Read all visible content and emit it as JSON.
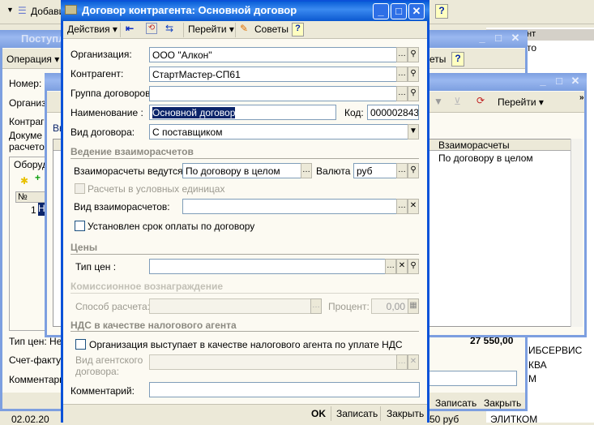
{
  "app": {
    "toolbar_add": "Добави",
    "help": "?"
  },
  "bg_list": {
    "header": "нт",
    "rows": [
      "то",
      "ИБСЕРВИС",
      "КВА",
      "М",
      "ЭЛИТКОМ"
    ],
    "bottom_row": {
      "date": "02.02.20",
      "sum": "50 руб"
    }
  },
  "doc_window": {
    "title": "Поступл",
    "operation": "Операция",
    "tips_fragment": "еты",
    "number_label": "Номер:",
    "org_label": "Организ",
    "counterparty_label": "Контраг",
    "doc_label": "Докуме",
    "settlements_label": "расчето",
    "group_tab": "Оборуд",
    "col_num": "№",
    "row_num": "1",
    "row_h": "Н",
    "price_type": "Тип цен: Не",
    "total": "27 550,00",
    "invoice": "Счет-фактур",
    "comment": "Комментари",
    "save": "Записать",
    "close": "Закрыть"
  },
  "journal_window": {
    "title": "Де",
    "goto": "Перейти",
    "link": "Вв",
    "col": "Взаиморасчеты",
    "row": "По договору в целом"
  },
  "dialog": {
    "title": "Договор контрагента: Основной договор",
    "toolbar": {
      "actions": "Действия",
      "goto": "Перейти",
      "tips": "Советы",
      "help": "?"
    },
    "organization": {
      "label": "Организация:",
      "value": "ООО \"Алкон\""
    },
    "counterparty": {
      "label": "Контрагент:",
      "value": "СтартМастер-СП61"
    },
    "group": {
      "label": "Группа договоров:",
      "value": ""
    },
    "name": {
      "label": "Наименование :",
      "value": "Основной договор"
    },
    "code": {
      "label": "Код:",
      "value": "000002843"
    },
    "type": {
      "label": "Вид договора:",
      "value": "С поставщиком"
    },
    "settlements": {
      "section": "Ведение взаиморасчетов",
      "mode_label": "Взаиморасчеты ведутся:",
      "mode_value": "По договору в целом",
      "currency_label": "Валюта :",
      "currency_value": "руб",
      "conv_units": "Расчеты в условных единицах",
      "conv_units_checked": false,
      "kind_label": "Вид взаиморасчетов:",
      "kind_value": "",
      "due_date": "Установлен срок оплаты по договору",
      "due_date_checked": false
    },
    "prices": {
      "section": "Цены",
      "type_label": "Тип цен :",
      "type_value": ""
    },
    "commission": {
      "section": "Комиссионное вознаграждение",
      "method_label": "Способ расчета:",
      "method_value": "",
      "percent_label": "Процент:",
      "percent_value": "0,00"
    },
    "vat": {
      "section": "НДС в качестве налогового агента",
      "agent": "Организация выступает в качестве налогового агента по уплате НДС",
      "agent_checked": false,
      "agent_contract_label1": "Вид агентского",
      "agent_contract_label2": "договора:",
      "agent_contract_value": ""
    },
    "comment": {
      "label": "Комментарий:",
      "value": ""
    },
    "footer": {
      "ok": "OK",
      "save": "Записать",
      "close": "Закрыть"
    }
  }
}
